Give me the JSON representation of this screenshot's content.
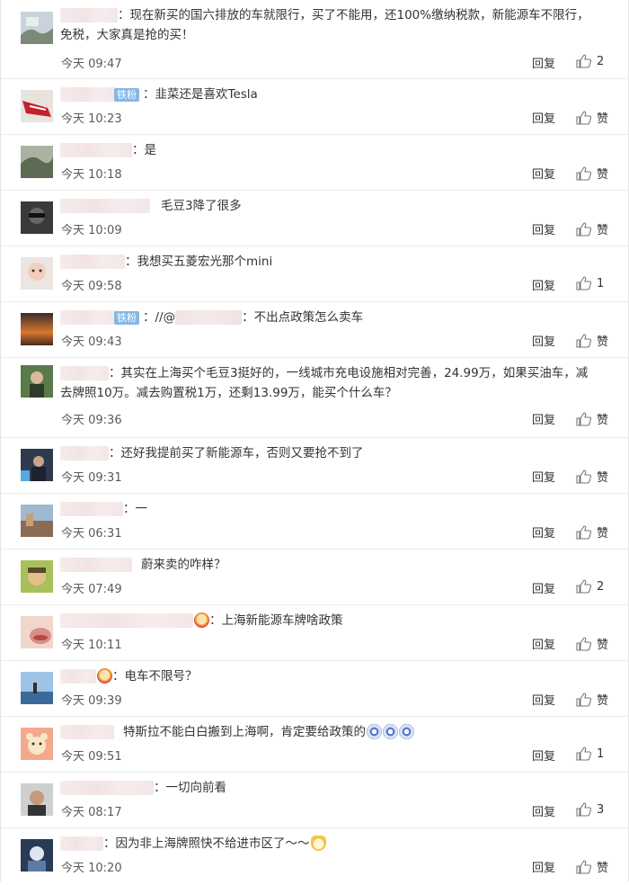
{
  "comments": [
    {
      "text": "：现在新买的国六排放的车就限行，买了不能用，还100%缴纳税款，新能源车不限行，",
      "text2": "免税，大家真是抢的买！",
      "time": "今天 09:47",
      "reply": "回复",
      "like": "2",
      "avatar": "avatar-1"
    },
    {
      "badge": "铁粉",
      "text": "：韭菜还是喜欢Tesla",
      "time": "今天 10:23",
      "reply": "回复",
      "like": "赞",
      "avatar": "avatar-2"
    },
    {
      "text": "：是",
      "time": "今天 10:18",
      "reply": "回复",
      "like": "赞",
      "avatar": "avatar-3"
    },
    {
      "text": "毛豆3降了很多",
      "time": "今天 10:09",
      "reply": "回复",
      "like": "赞",
      "avatar": "avatar-4"
    },
    {
      "text": "：我想买五菱宏光那个mini",
      "time": "今天 09:58",
      "reply": "回复",
      "like": "1",
      "avatar": "avatar-5"
    },
    {
      "badge": "铁粉",
      "text_pre": "：//@",
      "text": "：不出点政策怎么卖车",
      "time": "今天 09:43",
      "reply": "回复",
      "like": "赞",
      "avatar": "avatar-6"
    },
    {
      "text": "：其实在上海买个毛豆3挺好的，一线城市充电设施相对完善，24.99万，如果买油车，减",
      "text2": "去牌照10万。减去购置税1万，还剩13.99万，能买个什么车？",
      "time": "今天 09:36",
      "reply": "回复",
      "like": "赞",
      "avatar": "avatar-7"
    },
    {
      "text": "：还好我提前买了新能源车，否则又要抢不到了",
      "time": "今天 09:31",
      "reply": "回复",
      "like": "赞",
      "avatar": "avatar-8"
    },
    {
      "text": "：一",
      "time": "今天 06:31",
      "reply": "回复",
      "like": "赞",
      "avatar": "avatar-9"
    },
    {
      "text": "蔚来卖的咋样？",
      "time": "今天 07:49",
      "reply": "回复",
      "like": "2",
      "avatar": "avatar-10"
    },
    {
      "text": "：上海新能源车牌啥政策",
      "time": "今天 10:11",
      "reply": "回复",
      "like": "赞",
      "avatar": "avatar-11"
    },
    {
      "text": "：电车不限号？",
      "time": "今天 09:39",
      "reply": "回复",
      "like": "赞",
      "avatar": "avatar-12"
    },
    {
      "text": "特斯拉不能白白搬到上海啊，肯定要给政策的",
      "time": "今天 09:51",
      "reply": "回复",
      "like": "1",
      "avatar": "avatar-13"
    },
    {
      "text": "：一切向前看",
      "time": "今天 08:17",
      "reply": "回复",
      "like": "3",
      "avatar": "avatar-14"
    },
    {
      "text": "：因为非上海牌照快不给进市区了～～",
      "time": "今天 10:20",
      "reply": "回复",
      "like": "赞",
      "avatar": "avatar-15"
    }
  ]
}
